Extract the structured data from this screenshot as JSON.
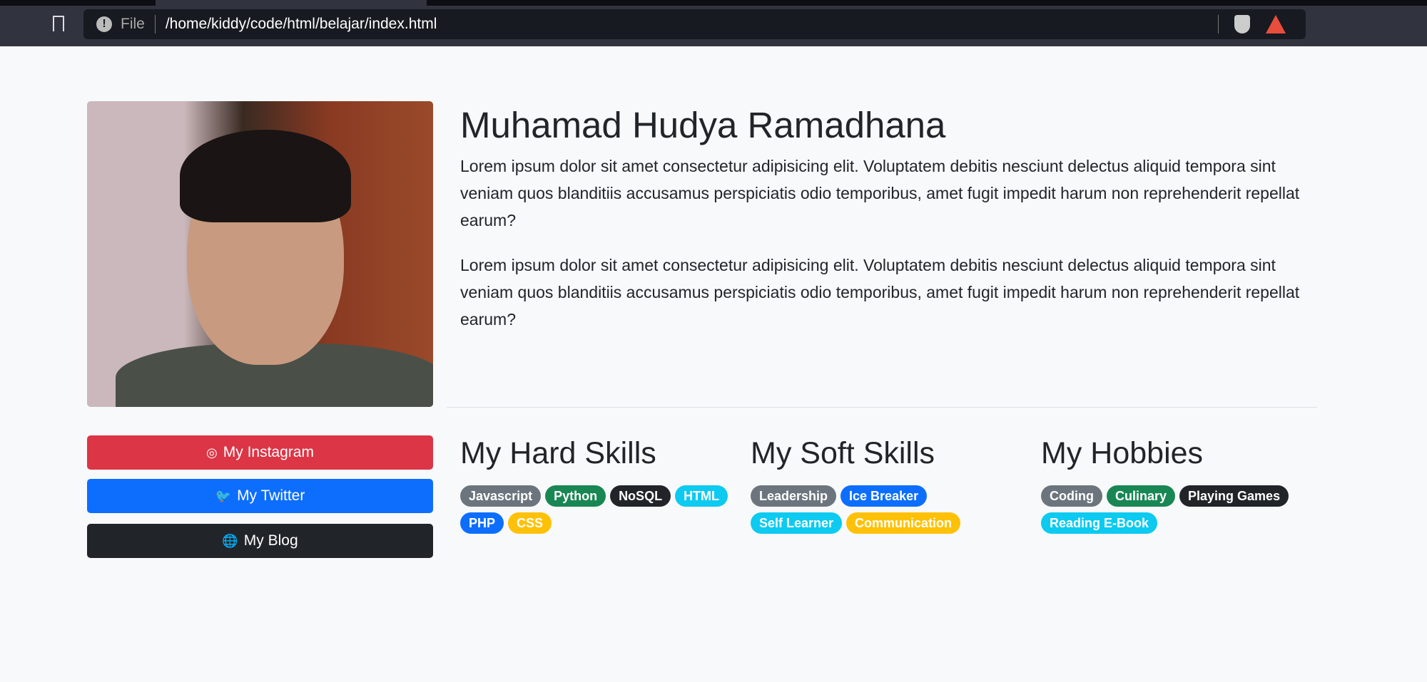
{
  "browser": {
    "url_scheme_label": "File",
    "url": "/home/kiddy/code/html/belajar/index.html"
  },
  "profile": {
    "name": "Muhamad Hudya Ramadhana",
    "paragraphs": [
      "Lorem ipsum dolor sit amet consectetur adipisicing elit. Voluptatem debitis nesciunt delectus aliquid tempora sint veniam quos blanditiis accusamus perspiciatis odio temporibus, amet fugit impedit harum non reprehenderit repellat earum?",
      "Lorem ipsum dolor sit amet consectetur adipisicing elit. Voluptatem debitis nesciunt delectus aliquid tempora sint veniam quos blanditiis accusamus perspiciatis odio temporibus, amet fugit impedit harum non reprehenderit repellat earum?"
    ]
  },
  "links": [
    {
      "label": "My Instagram",
      "icon": "instagram-icon",
      "color": "#dc3545"
    },
    {
      "label": "My Twitter",
      "icon": "twitter-icon",
      "color": "#0d6efd"
    },
    {
      "label": "My Blog",
      "icon": "globe-icon",
      "color": "#212529"
    }
  ],
  "sections": [
    {
      "title": "My Hard Skills",
      "badges": [
        {
          "label": "Javascript",
          "color": "#6c757d"
        },
        {
          "label": "Python",
          "color": "#198754"
        },
        {
          "label": "NoSQL",
          "color": "#212529"
        },
        {
          "label": "HTML",
          "color": "#0dcaf0"
        },
        {
          "label": "PHP",
          "color": "#0d6efd"
        },
        {
          "label": "CSS",
          "color": "#ffc107"
        }
      ]
    },
    {
      "title": "My Soft Skills",
      "badges": [
        {
          "label": "Leadership",
          "color": "#6c757d"
        },
        {
          "label": "Ice Breaker",
          "color": "#0d6efd"
        },
        {
          "label": "Self Learner",
          "color": "#0dcaf0"
        },
        {
          "label": "Communication",
          "color": "#ffc107"
        }
      ]
    },
    {
      "title": "My Hobbies",
      "badges": [
        {
          "label": "Coding",
          "color": "#6c757d"
        },
        {
          "label": "Culinary",
          "color": "#198754"
        },
        {
          "label": "Playing Games",
          "color": "#212529"
        },
        {
          "label": "Reading E-Book",
          "color": "#0dcaf0"
        }
      ]
    }
  ]
}
